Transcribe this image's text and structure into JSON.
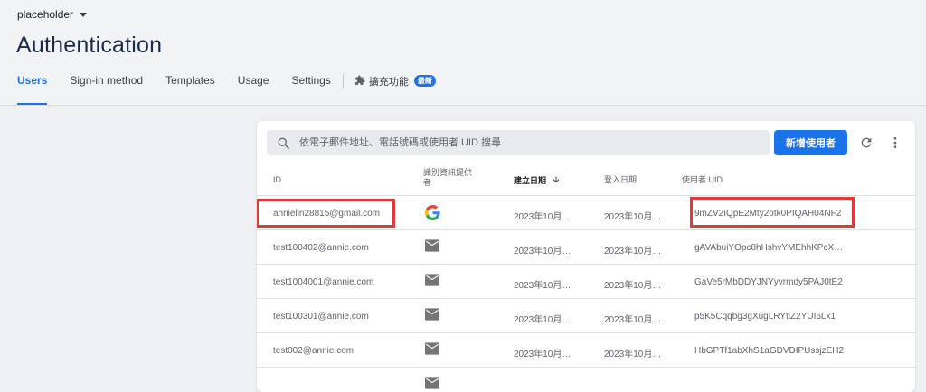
{
  "header": {
    "project": "placeholder",
    "title": "Authentication",
    "tabs": [
      {
        "label": "Users",
        "active": true
      },
      {
        "label": "Sign-in method"
      },
      {
        "label": "Templates"
      },
      {
        "label": "Usage"
      },
      {
        "label": "Settings"
      }
    ],
    "extensions": {
      "label": "擴充功能",
      "badge": "最新"
    }
  },
  "toolbar": {
    "search_placeholder": "依電子郵件地址、電話號碼或使用者 UID 搜尋",
    "add_user_label": "新增使用者"
  },
  "table": {
    "columns": {
      "id": "ID",
      "provider": "識別資訊提供者",
      "created": "建立日期",
      "signed_in": "登入日期",
      "uid": "使用者 UID"
    },
    "rows": [
      {
        "id": "annielin28815@gmail.com",
        "provider": "google-icon",
        "created": "2023年10月…",
        "signed_in": "2023年10月…",
        "uid": "9mZV2IQpE2Mty2otk0PIQAH04NF2"
      },
      {
        "id": "test100402@annie.com",
        "provider": "mail-icon",
        "created": "2023年10月…",
        "signed_in": "2023年10月…",
        "uid": "gAVAbuiYOpc8hHshvYMEhhKPcX…"
      },
      {
        "id": "test1004001@annie.com",
        "provider": "mail-icon",
        "created": "2023年10月…",
        "signed_in": "2023年10月…",
        "uid": "GaVe5rMbDDYJNYyvrmdy5PAJ0tE2"
      },
      {
        "id": "test100301@annie.com",
        "provider": "mail-icon",
        "created": "2023年10月…",
        "signed_in": "2023年10月…",
        "uid": "p5K5Cqqbg3gXugLRYtiZ2YUI6Lx1"
      },
      {
        "id": "test002@annie.com",
        "provider": "mail-icon",
        "created": "2023年10月…",
        "signed_in": "2023年10月…",
        "uid": "HbGPTf1abXhS1aGDVDIPUssjzEH2"
      },
      {
        "id": "",
        "provider": "mail-icon",
        "created": "",
        "signed_in": "",
        "uid": ""
      }
    ]
  },
  "colors": {
    "accent": "#1a73e8",
    "highlight": "#e53935",
    "title": "#1a2b4c"
  }
}
